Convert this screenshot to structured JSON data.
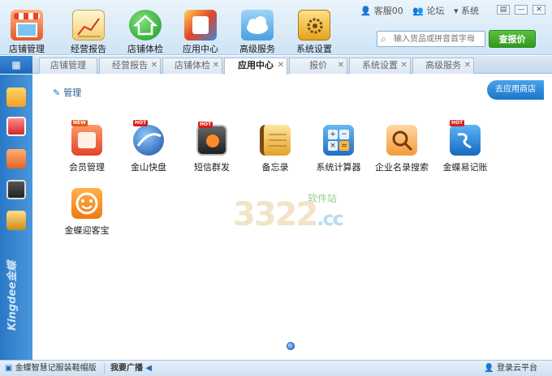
{
  "toolbar": {
    "items": [
      {
        "label": "店铺管理",
        "icon": "store-icon"
      },
      {
        "label": "经营报告",
        "icon": "report-chart-icon"
      },
      {
        "label": "店铺体检",
        "icon": "house-check-icon"
      },
      {
        "label": "应用中心",
        "icon": "app-center-icon"
      },
      {
        "label": "高级服务",
        "icon": "cloud-icon"
      },
      {
        "label": "系统设置",
        "icon": "settings-box-icon"
      }
    ],
    "links": [
      "客服00",
      "论坛",
      "系统"
    ],
    "search_placeholder": "输入货品或拼音首字母",
    "search_button": "查报价"
  },
  "tabs": [
    {
      "label": "店铺管理",
      "closable": false
    },
    {
      "label": "经营报告",
      "closable": true
    },
    {
      "label": "店铺体检",
      "closable": true
    },
    {
      "label": "应用中心",
      "closable": true,
      "active": true
    },
    {
      "label": "报价",
      "closable": true
    },
    {
      "label": "系统设置",
      "closable": true
    },
    {
      "label": "高级服务",
      "closable": true
    }
  ],
  "sidebar": {
    "brand": "Kingdee金蝶"
  },
  "main": {
    "breadcrumb": "管理",
    "store_button": "去应用商店",
    "apps": [
      {
        "label": "会员管理",
        "icon": "member-card-icon",
        "badge": "NEW"
      },
      {
        "label": "金山快盘",
        "icon": "kuaipan-globe-icon",
        "badge": "HOT"
      },
      {
        "label": "短信群发",
        "icon": "sms-phone-icon",
        "badge": "HOT"
      },
      {
        "label": "备忘录",
        "icon": "memo-notebook-icon",
        "badge": ""
      },
      {
        "label": "系统计算器",
        "icon": "calculator-icon",
        "badge": ""
      },
      {
        "label": "企业名录搜索",
        "icon": "directory-search-icon",
        "badge": ""
      },
      {
        "label": "金蝶易记账",
        "icon": "kingdee-account-icon",
        "badge": "HOT"
      },
      {
        "label": "金蝶迎客宝",
        "icon": "smiley-icon",
        "badge": ""
      }
    ],
    "watermark": "3322",
    "watermark_suffix": ".cc",
    "watermark_cn": "软件站"
  },
  "statusbar": {
    "left": "金蝶智慧记服装鞋帽版",
    "broadcast": "我要广播",
    "right": "登录云平台"
  },
  "colors": {
    "accent": "#1f69b8",
    "search_button": "#2e9a1f",
    "hot_badge": "#d61f1f"
  }
}
